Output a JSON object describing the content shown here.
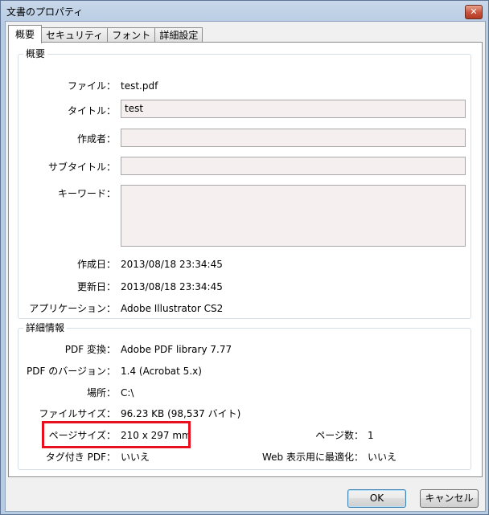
{
  "window": {
    "title": "文書のプロパティ",
    "close": "✕"
  },
  "tabs": [
    "概要",
    "セキュリティ",
    "フォント",
    "詳細設定"
  ],
  "overview": {
    "group_label": "概要",
    "file_label": "ファイル：",
    "file_value": "test.pdf",
    "title_label": "タイトル：",
    "title_value": "test",
    "author_label": "作成者：",
    "author_value": "",
    "subject_label": "サブタイトル：",
    "subject_value": "",
    "keywords_label": "キーワード：",
    "keywords_value": "",
    "created_label": "作成日：",
    "created_value": "2013/08/18 23:34:45",
    "modified_label": "更新日：",
    "modified_value": "2013/08/18 23:34:45",
    "application_label": "アプリケーション：",
    "application_value": "Adobe Illustrator CS2"
  },
  "details": {
    "group_label": "詳細情報",
    "producer_label": "PDF 変換：",
    "producer_value": "Adobe PDF library 7.77",
    "version_label": "PDF のバージョン：",
    "version_value": "1.4 (Acrobat 5.x)",
    "location_label": "場所：",
    "location_value": "C:\\",
    "filesize_label": "ファイルサイズ：",
    "filesize_value": "96.23 KB (98,537 バイト)",
    "pagesize_label": "ページサイズ：",
    "pagesize_value": "210 x 297 mm",
    "pages_label": "ページ数：",
    "pages_value": "1",
    "tagged_label": "タグ付き PDF：",
    "tagged_value": "いいえ",
    "fastweb_label": "Web 表示用に最適化：",
    "fastweb_value": "いいえ"
  },
  "buttons": {
    "ok": "OK",
    "cancel": "キャンセル"
  },
  "colors": {
    "highlight": "#e8101e",
    "field_bg": "#f5eff0"
  }
}
